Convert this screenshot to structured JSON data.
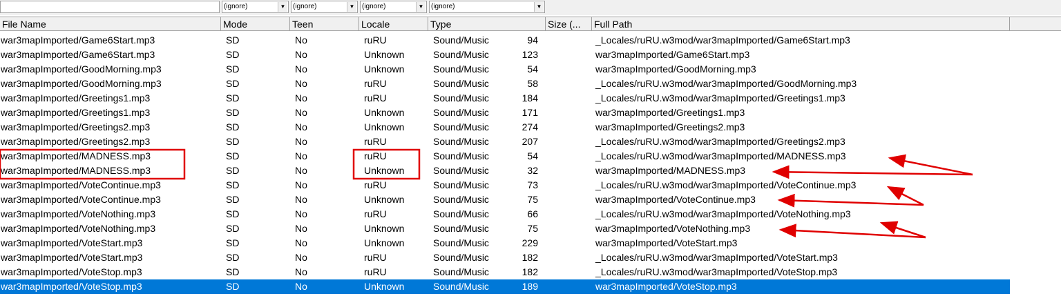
{
  "filters": {
    "file_name": "",
    "mode": "(ignore)",
    "teen": "(ignore)",
    "locale": "(ignore)",
    "type": "(ignore)"
  },
  "columns": [
    "File Name",
    "Mode",
    "Teen",
    "Locale",
    "Type",
    "Size (...",
    "Full Path"
  ],
  "rows": [
    [
      "war3mapImported/Game6Start.mp3",
      "SD",
      "No",
      "ruRU",
      "Sound/Music",
      "94",
      "_Locales/ruRU.w3mod/war3mapImported/Game6Start.mp3"
    ],
    [
      "war3mapImported/Game6Start.mp3",
      "SD",
      "No",
      "Unknown",
      "Sound/Music",
      "123",
      "war3mapImported/Game6Start.mp3"
    ],
    [
      "war3mapImported/GoodMorning.mp3",
      "SD",
      "No",
      "Unknown",
      "Sound/Music",
      "54",
      "war3mapImported/GoodMorning.mp3"
    ],
    [
      "war3mapImported/GoodMorning.mp3",
      "SD",
      "No",
      "ruRU",
      "Sound/Music",
      "58",
      "_Locales/ruRU.w3mod/war3mapImported/GoodMorning.mp3"
    ],
    [
      "war3mapImported/Greetings1.mp3",
      "SD",
      "No",
      "ruRU",
      "Sound/Music",
      "184",
      "_Locales/ruRU.w3mod/war3mapImported/Greetings1.mp3"
    ],
    [
      "war3mapImported/Greetings1.mp3",
      "SD",
      "No",
      "Unknown",
      "Sound/Music",
      "171",
      "war3mapImported/Greetings1.mp3"
    ],
    [
      "war3mapImported/Greetings2.mp3",
      "SD",
      "No",
      "Unknown",
      "Sound/Music",
      "274",
      "war3mapImported/Greetings2.mp3"
    ],
    [
      "war3mapImported/Greetings2.mp3",
      "SD",
      "No",
      "ruRU",
      "Sound/Music",
      "207",
      "_Locales/ruRU.w3mod/war3mapImported/Greetings2.mp3"
    ],
    [
      "war3mapImported/MADNESS.mp3",
      "SD",
      "No",
      "ruRU",
      "Sound/Music",
      "54",
      "_Locales/ruRU.w3mod/war3mapImported/MADNESS.mp3"
    ],
    [
      "war3mapImported/MADNESS.mp3",
      "SD",
      "No",
      "Unknown",
      "Sound/Music",
      "32",
      "war3mapImported/MADNESS.mp3"
    ],
    [
      "war3mapImported/VoteContinue.mp3",
      "SD",
      "No",
      "ruRU",
      "Sound/Music",
      "73",
      "_Locales/ruRU.w3mod/war3mapImported/VoteContinue.mp3"
    ],
    [
      "war3mapImported/VoteContinue.mp3",
      "SD",
      "No",
      "Unknown",
      "Sound/Music",
      "75",
      "war3mapImported/VoteContinue.mp3"
    ],
    [
      "war3mapImported/VoteNothing.mp3",
      "SD",
      "No",
      "ruRU",
      "Sound/Music",
      "66",
      "_Locales/ruRU.w3mod/war3mapImported/VoteNothing.mp3"
    ],
    [
      "war3mapImported/VoteNothing.mp3",
      "SD",
      "No",
      "Unknown",
      "Sound/Music",
      "75",
      "war3mapImported/VoteNothing.mp3"
    ],
    [
      "war3mapImported/VoteStart.mp3",
      "SD",
      "No",
      "Unknown",
      "Sound/Music",
      "229",
      "war3mapImported/VoteStart.mp3"
    ],
    [
      "war3mapImported/VoteStart.mp3",
      "SD",
      "No",
      "ruRU",
      "Sound/Music",
      "182",
      "_Locales/ruRU.w3mod/war3mapImported/VoteStart.mp3"
    ],
    [
      "war3mapImported/VoteStop.mp3",
      "SD",
      "No",
      "ruRU",
      "Sound/Music",
      "182",
      "_Locales/ruRU.w3mod/war3mapImported/VoteStop.mp3"
    ],
    [
      "war3mapImported/VoteStop.mp3",
      "SD",
      "No",
      "Unknown",
      "Sound/Music",
      "189",
      "war3mapImported/VoteStop.mp3"
    ]
  ],
  "selected_row": 17,
  "colors": {
    "selection": "#0078d7",
    "annotation": "#e00000"
  }
}
